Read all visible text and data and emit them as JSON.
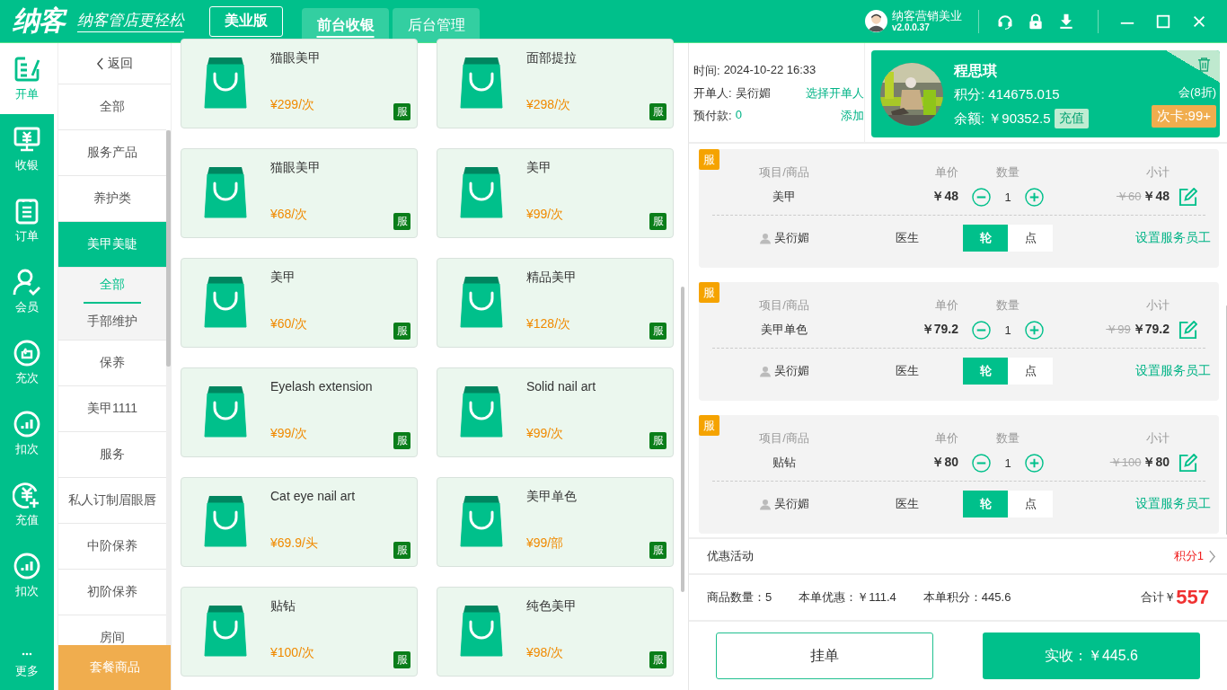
{
  "header": {
    "logo": "纳客",
    "slogan": "纳客管店更轻松",
    "edition": "美业版",
    "tabs": [
      {
        "label": "前台收银",
        "selected": true
      },
      {
        "label": "后台管理",
        "selected": false
      }
    ],
    "user": {
      "name": "纳客营销美业",
      "version": "v2.0.0.37"
    }
  },
  "nav": [
    {
      "label": "开单",
      "selected": true
    },
    {
      "label": "收银",
      "selected": false
    },
    {
      "label": "订单",
      "selected": false
    },
    {
      "label": "会员",
      "selected": false
    },
    {
      "label": "充次",
      "selected": false
    },
    {
      "label": "扣次",
      "selected": false
    },
    {
      "label": "充值",
      "selected": false
    },
    {
      "label": "扣次",
      "selected": false
    },
    {
      "label": "更多",
      "selected": false
    }
  ],
  "categories": {
    "back": "返回",
    "items": [
      {
        "label": "全部",
        "selected": false
      },
      {
        "label": "服务产品",
        "selected": false
      },
      {
        "label": "养护类",
        "selected": false
      },
      {
        "label": "美甲美睫",
        "selected": true,
        "children": [
          {
            "label": "全部",
            "selected": true
          },
          {
            "label": "手部维护",
            "selected": false
          }
        ]
      },
      {
        "label": "保养",
        "selected": false
      },
      {
        "label": "美甲1111",
        "selected": false
      },
      {
        "label": "服务",
        "selected": false
      },
      {
        "label": "私人订制眉眼唇",
        "selected": false
      },
      {
        "label": "中阶保养",
        "selected": false
      },
      {
        "label": "初阶保养",
        "selected": false
      },
      {
        "label": "房间",
        "selected": false
      }
    ],
    "footer": "套餐商品"
  },
  "products": [
    {
      "name": "猫眼美甲",
      "price": "¥299/次",
      "badge": "服"
    },
    {
      "name": "面部提拉",
      "price": "¥298/次",
      "badge": "服"
    },
    {
      "name": "猫眼美甲",
      "price": "¥68/次",
      "badge": "服"
    },
    {
      "name": "美甲",
      "price": "¥99/次",
      "badge": "服"
    },
    {
      "name": "美甲",
      "price": "¥60/次",
      "badge": "服"
    },
    {
      "name": "精品美甲",
      "price": "¥128/次",
      "badge": "服"
    },
    {
      "name": "Eyelash extension",
      "price": "¥99/次",
      "badge": "服"
    },
    {
      "name": "Solid nail art",
      "price": "¥99/次",
      "badge": "服"
    },
    {
      "name": "Cat eye nail art",
      "price": "¥69.9/头",
      "badge": "服"
    },
    {
      "name": "美甲单色",
      "price": "¥99/部",
      "badge": "服"
    },
    {
      "name": "贴钻",
      "price": "¥100/次",
      "badge": "服"
    },
    {
      "name": "纯色美甲",
      "price": "¥98/次",
      "badge": "服"
    }
  ],
  "order": {
    "time_label": "时间:",
    "time": "2024-10-22 16:33",
    "operator_label": "开单人:",
    "operator": "吴衍媚",
    "operator_link": "选择开单人",
    "prepaid_label": "预付款:",
    "prepaid": "0",
    "prepaid_link": "添加"
  },
  "member": {
    "name": "程思琪",
    "points": "积分: 414675.015",
    "balance": "余额: ￥90352.5",
    "recharge": "充值",
    "level": "会(8折)",
    "card": "次卡:99+"
  },
  "items": [
    {
      "badge": "服",
      "headers": [
        "项目/商品",
        "单价",
        "数量",
        "小计"
      ],
      "name": "美甲",
      "price": "￥48",
      "qty": "1",
      "original": "￥60",
      "subtotal": "￥48",
      "staff": "吴衍媚",
      "role": "医生",
      "modes": [
        {
          "label": "轮",
          "selected": true
        },
        {
          "label": "点",
          "selected": false
        }
      ],
      "assign": "设置服务员工"
    },
    {
      "badge": "服",
      "headers": [
        "项目/商品",
        "单价",
        "数量",
        "小计"
      ],
      "name": "美甲单色",
      "price": "￥79.2",
      "qty": "1",
      "original": "￥99",
      "subtotal": "￥79.2",
      "staff": "吴衍媚",
      "role": "医生",
      "modes": [
        {
          "label": "轮",
          "selected": true
        },
        {
          "label": "点",
          "selected": false
        }
      ],
      "assign": "设置服务员工"
    },
    {
      "badge": "服",
      "headers": [
        "项目/商品",
        "单价",
        "数量",
        "小计"
      ],
      "name": "贴钻",
      "price": "￥80",
      "qty": "1",
      "original": "￥100",
      "subtotal": "￥80",
      "staff": "吴衍媚",
      "role": "医生",
      "modes": [
        {
          "label": "轮",
          "selected": true
        },
        {
          "label": "点",
          "selected": false
        }
      ],
      "assign": "设置服务员工"
    }
  ],
  "promotion": {
    "label": "优惠活动",
    "value": "积分1"
  },
  "summary": {
    "count": "商品数量：5",
    "discount": "本单优惠：￥111.4",
    "points": "本单积分：445.6",
    "total_label": "合计￥",
    "total": "557"
  },
  "buttons": {
    "hold": "挂单",
    "pay": "实收：￥445.6"
  }
}
